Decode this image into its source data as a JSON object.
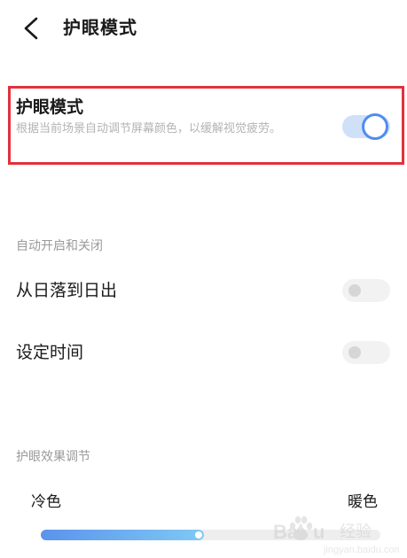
{
  "header": {
    "title": "护眼模式",
    "back_icon": "chevron-left-icon"
  },
  "eye_protection": {
    "title": "护眼模式",
    "description": "根据当前场景自动调节屏幕颜色，以缓解视觉疲劳。",
    "enabled": true,
    "accent_color": "#4f8cf2",
    "highlight_color": "#e0323c"
  },
  "auto_section": {
    "label": "自动开启和关闭",
    "items": [
      {
        "label": "从日落到日出",
        "enabled": false
      },
      {
        "label": "设定时间",
        "enabled": false
      }
    ]
  },
  "effect_section": {
    "label": "护眼效果调节",
    "cold_label": "冷色",
    "warm_label": "暖色",
    "level_fraction": 0.48
  },
  "watermark": {
    "logo_text": "Baidu",
    "caption": "经验"
  }
}
